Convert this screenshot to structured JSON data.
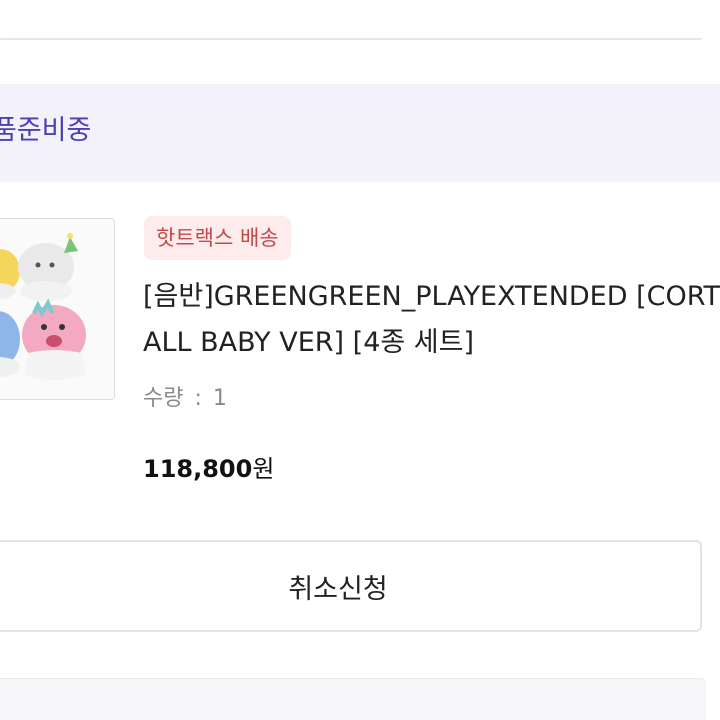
{
  "order": {
    "status": "품준비중"
  },
  "product": {
    "image_icon": "album-photo-icon",
    "badge": "핫트랙스 배송",
    "title_line1": "[음반]GREENGREEN_PLAYEXTENDED [CORT",
    "title_line2": "ALL BABY VER] [4종 세트]",
    "quantity_label": "수량",
    "quantity_sep": ":",
    "quantity_value": "1",
    "price_value": "118,800",
    "price_unit": "원"
  },
  "actions": {
    "cancel_label": "취소신청"
  },
  "colors": {
    "accent": "#4b3fb4",
    "status_bg": "#f3f2fb",
    "badge_bg": "#fdeceb",
    "badge_text": "#c24a4a"
  }
}
